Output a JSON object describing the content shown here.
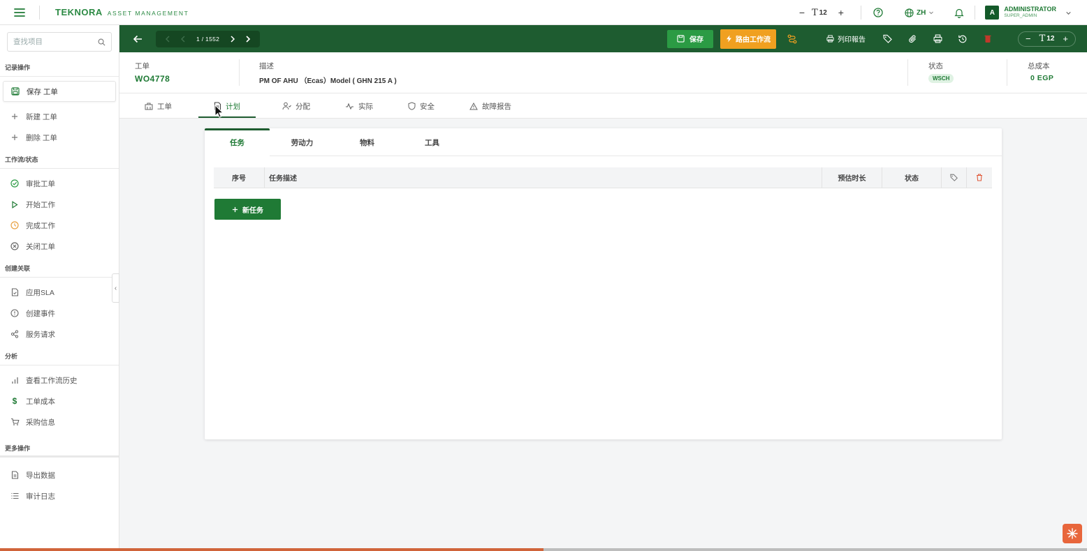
{
  "topbar": {
    "brand": "TEKNORA",
    "brand_sub": "ASSET MANAGEMENT",
    "font_minus": "−",
    "font_t": "T",
    "font_size": "12",
    "font_plus": "+",
    "lang": "ZH",
    "user_initial": "A",
    "user_name": "ADMINISTRATOR",
    "user_role": "SUPER_ADMIN"
  },
  "sidebar": {
    "search_placeholder": "查找项目",
    "sections": {
      "record": "记录操作",
      "workflow": "工作流/状态",
      "create": "创建关联",
      "analysis": "分析",
      "more": "更多操作"
    },
    "items": {
      "save": "保存 工单",
      "new": "新建 工单",
      "delete": "删除 工单",
      "approve": "审批工单",
      "start": "开始工作",
      "complete": "完成工作",
      "close": "关闭工单",
      "sla": "应用SLA",
      "incident": "创建事件",
      "service": "服务请求",
      "history": "查看工作流历史",
      "cost": "工单成本",
      "purchase": "采购信息",
      "export": "导出数据",
      "audit": "审计日志"
    },
    "collapse_glyph": "‹"
  },
  "toolbar": {
    "page_current": "1",
    "page_sep": "/",
    "page_total": "1552",
    "save_label": "保存",
    "route_label": "路由工作流",
    "print_report": "列印報告",
    "font_minus": "−",
    "font_t": "T",
    "font_size": "12",
    "font_plus": "+"
  },
  "header": {
    "wo_label": "工单",
    "wo_value": "WO4778",
    "desc_label": "描述",
    "desc_value": "PM OF AHU （Ecas）Model ( GHN 215 A )",
    "status_label": "状态",
    "status_value": "WSCH",
    "cost_label": "总成本",
    "cost_value": "0 EGP"
  },
  "tabs": {
    "workorder": "工单",
    "plan": "计划",
    "assign": "分配",
    "actual": "实际",
    "safety": "安全",
    "failure": "故障报告"
  },
  "plan": {
    "subtabs": {
      "tasks": "任务",
      "labor": "劳动力",
      "materials": "物料",
      "tools": "工具"
    },
    "columns": {
      "seq": "序号",
      "desc": "任务描述",
      "duration": "预估时长",
      "status": "状态"
    },
    "add_task": "新任务"
  },
  "progress": {
    "fraction": 0.5
  },
  "colors": {
    "primary": "#1e5c30",
    "accent": "#2b9b44",
    "route": "#f0a020",
    "danger": "#e05a3a"
  }
}
